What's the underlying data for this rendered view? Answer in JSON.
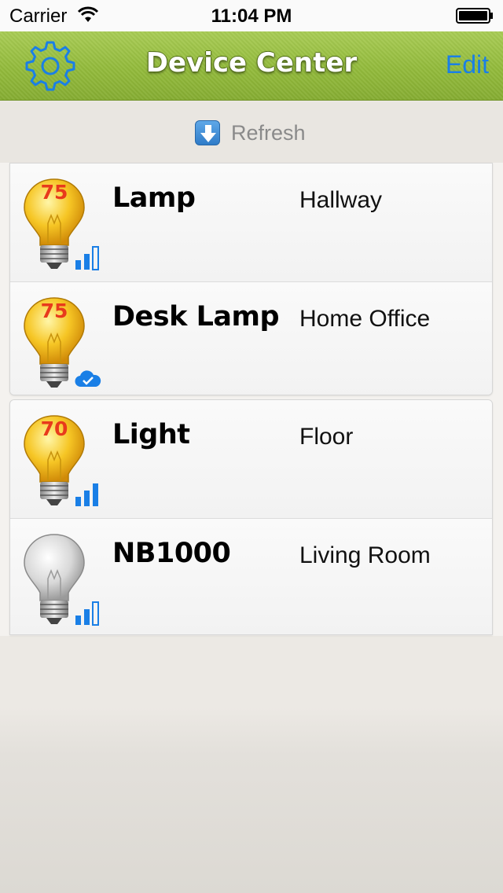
{
  "status_bar": {
    "carrier": "Carrier",
    "time": "11:04 PM"
  },
  "nav": {
    "title": "Device Center",
    "edit_label": "Edit",
    "settings_icon": "gear-icon",
    "accent_color": "#1a7fe6",
    "bar_color": "#93bb3c"
  },
  "refresh": {
    "label": "Refresh",
    "icon": "download-arrow-icon"
  },
  "groups": [
    {
      "devices": [
        {
          "name": "Lamp",
          "location": "Hallway",
          "level": "75",
          "bulb": "on",
          "status_icon": "signal-icon"
        },
        {
          "name": "Desk Lamp",
          "location": "Home Office",
          "level": "75",
          "bulb": "on",
          "status_icon": "cloud-check-icon"
        }
      ]
    },
    {
      "devices": [
        {
          "name": "Light",
          "location": "Floor",
          "level": "70",
          "bulb": "on",
          "status_icon": "signal-icon"
        },
        {
          "name": "NB1000",
          "location": "Living Room",
          "level": "",
          "bulb": "off",
          "status_icon": "signal-icon"
        }
      ]
    }
  ]
}
